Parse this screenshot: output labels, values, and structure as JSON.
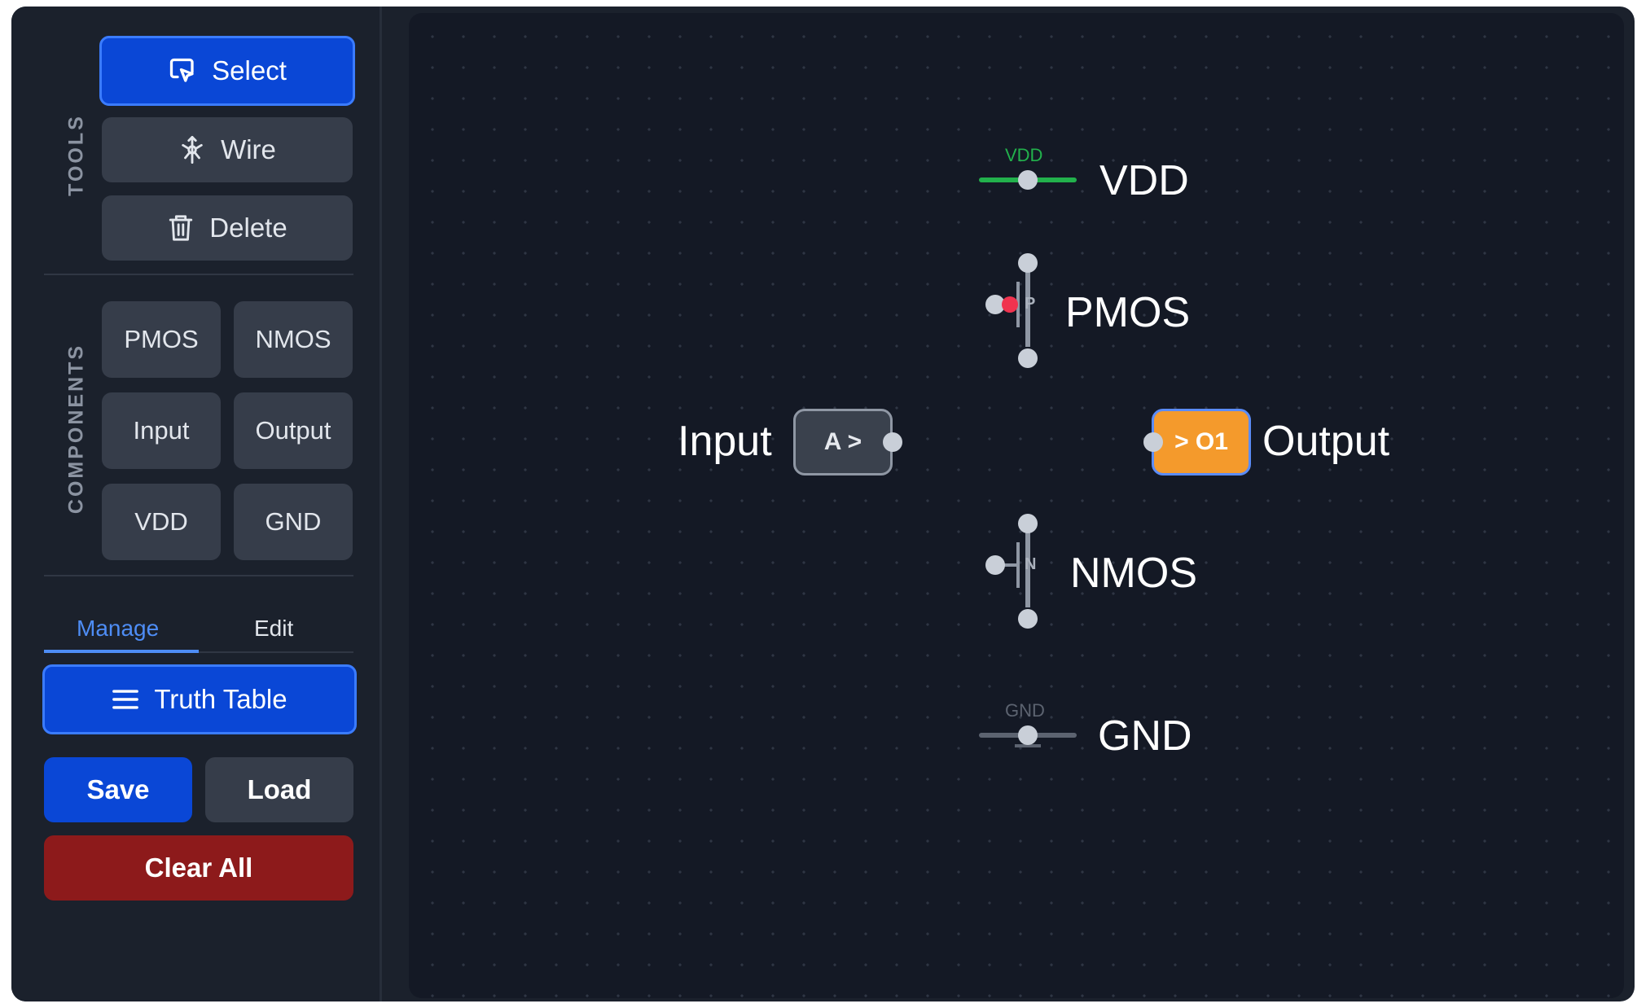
{
  "sidebar": {
    "tools_heading": "TOOLS",
    "tools": {
      "select": "Select",
      "wire": "Wire",
      "delete": "Delete"
    },
    "components_heading": "COMPONENTS",
    "components": [
      "PMOS",
      "NMOS",
      "Input",
      "Output",
      "VDD",
      "GND"
    ],
    "tabs": {
      "manage": "Manage",
      "edit": "Edit",
      "active": "Manage"
    },
    "truth_table": "Truth Table",
    "save": "Save",
    "load": "Load",
    "clear_all": "Clear All"
  },
  "canvas": {
    "vdd": {
      "rail_label": "VDD",
      "label": "VDD",
      "color": "#22b14c"
    },
    "pmos": {
      "letter": "P",
      "label": "PMOS",
      "gate_dot_color": "#f0334f"
    },
    "input": {
      "node_text": "A >",
      "label": "Input"
    },
    "output": {
      "node_text": "> O1",
      "label": "Output",
      "color": "#f49a2c"
    },
    "nmos": {
      "letter": "N",
      "label": "NMOS"
    },
    "gnd": {
      "rail_label": "GND",
      "label": "GND",
      "color": "#5c6370"
    }
  },
  "colors": {
    "accent": "#0a47d6",
    "danger": "#8d1a1b",
    "canvas_bg": "#141925",
    "sidebar_bg": "#1b212c"
  }
}
